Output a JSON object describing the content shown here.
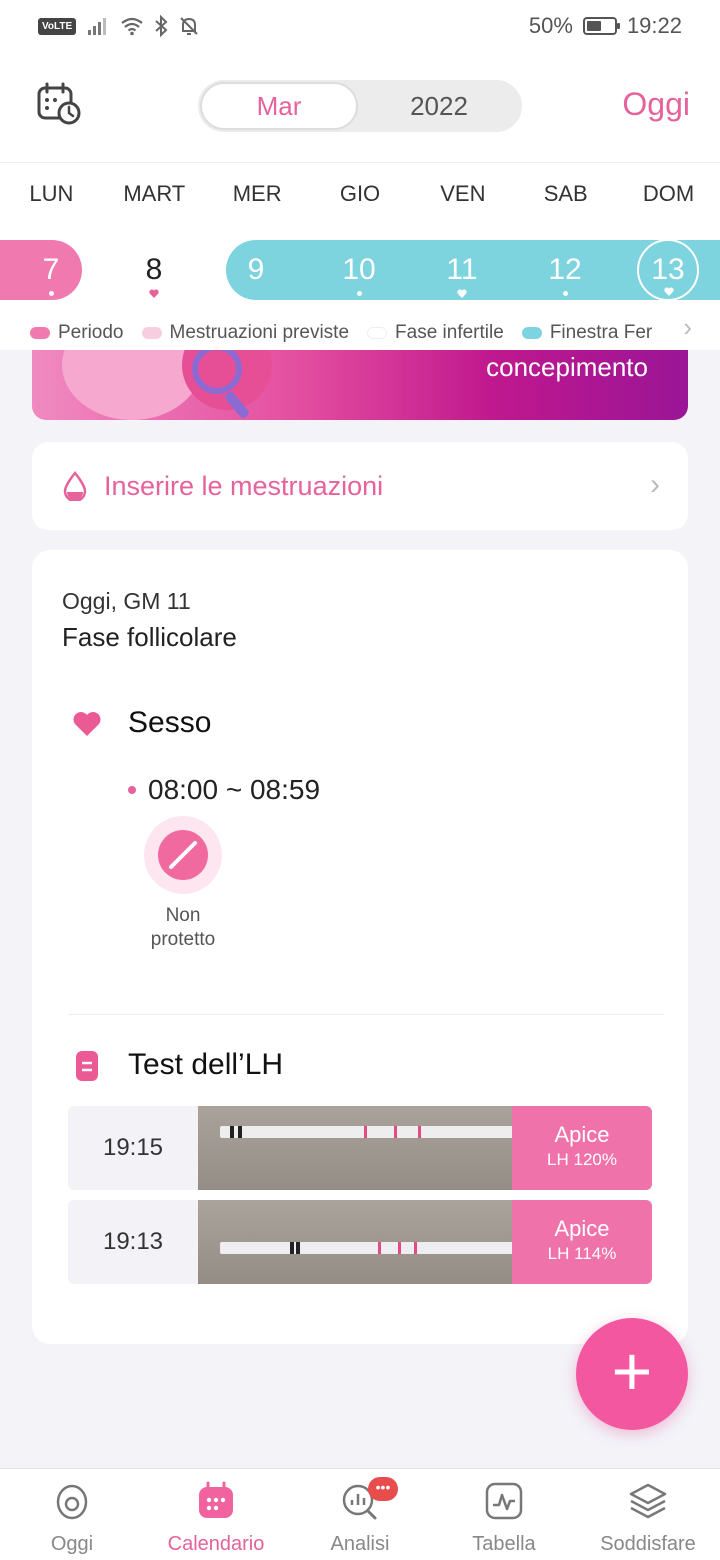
{
  "status_bar": {
    "volte": "VoLTE",
    "battery": "50%",
    "battery_level": 0.5,
    "time": "19:22"
  },
  "header": {
    "month": "Mar",
    "year": "2022",
    "today_label": "Oggi"
  },
  "weekdays": [
    "LUN",
    "MART",
    "MER",
    "GIO",
    "VEN",
    "SAB",
    "DOM"
  ],
  "dates": [
    "7",
    "8",
    "9",
    "10",
    "11",
    "12",
    "13"
  ],
  "legend": [
    {
      "label": "Periodo",
      "color": "#f07ab0"
    },
    {
      "label": "Mestruazioni previste",
      "color": "#f9cde0"
    },
    {
      "label": "Fase infertile",
      "color": "#ffffff"
    },
    {
      "label": "Finestra Fer",
      "color": "#7dd3de"
    }
  ],
  "banner": {
    "text": "concepimento"
  },
  "insert_card": {
    "label": "Inserire le mestruazioni"
  },
  "today_card": {
    "date": "Oggi, GM 11",
    "phase": "Fase follicolare",
    "sex": {
      "title": "Sesso",
      "time": "08:00 ~ 08:59",
      "status_line1": "Non",
      "status_line2": "protetto"
    },
    "lh": {
      "title": "Test dell’LH",
      "rows": [
        {
          "time": "19:15",
          "result": "Apice",
          "value": "LH 120%"
        },
        {
          "time": "19:13",
          "result": "Apice",
          "value": "LH 114%"
        }
      ]
    }
  },
  "nav": [
    {
      "label": "Oggi",
      "icon": "home-egg-icon"
    },
    {
      "label": "Calendario",
      "icon": "calendar-icon"
    },
    {
      "label": "Analisi",
      "icon": "analysis-icon",
      "badge": "•••"
    },
    {
      "label": "Tabella",
      "icon": "chart-icon"
    },
    {
      "label": "Soddisfare",
      "icon": "layers-icon"
    }
  ],
  "colors": {
    "accent": "#e6629b",
    "period": "#f07ab0",
    "fertile": "#7dd3de",
    "apex": "#f072aa"
  }
}
